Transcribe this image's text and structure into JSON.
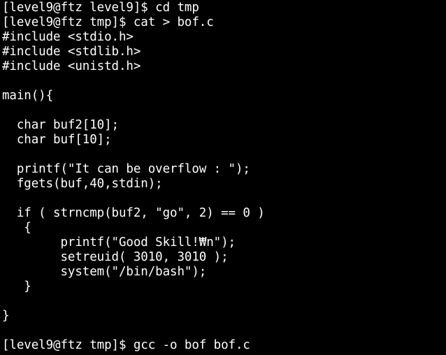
{
  "terminal": {
    "lines": [
      "[level9@ftz level9]$ cd tmp",
      "[level9@ftz tmp]$ cat > bof.c",
      "#include <stdio.h>",
      "#include <stdlib.h>",
      "#include <unistd.h>",
      "",
      "main(){",
      "",
      "  char buf2[10];",
      "  char buf[10];",
      "",
      "  printf(\"It can be overflow : \");",
      "  fgets(buf,40,stdin);",
      "",
      "  if ( strncmp(buf2, \"go\", 2) == 0 )",
      "   {",
      "        printf(\"Good Skill!₩n\");",
      "        setreuid( 3010, 3010 );",
      "        system(\"/bin/bash\");",
      "   }",
      "",
      "}",
      "",
      "[level9@ftz tmp]$ gcc -o bof bof.c"
    ]
  },
  "colors": {
    "background": "#000000",
    "foreground": "#ffffff"
  }
}
